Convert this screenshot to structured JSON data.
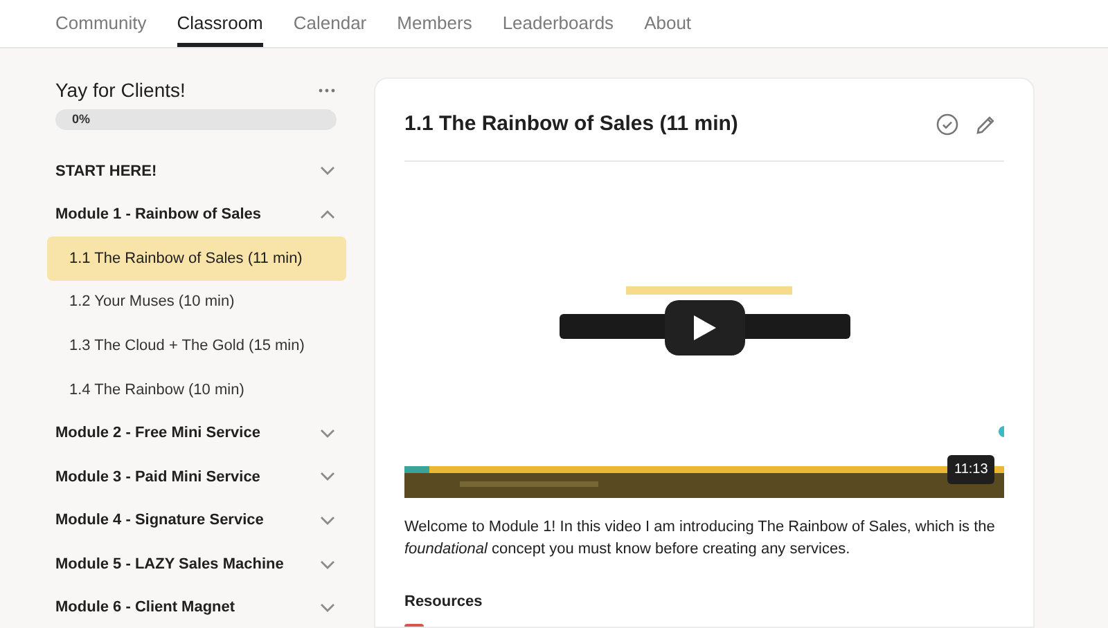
{
  "nav": [
    {
      "label": "Community",
      "selected": false
    },
    {
      "label": "Classroom",
      "selected": true
    },
    {
      "label": "Calendar",
      "selected": false
    },
    {
      "label": "Members",
      "selected": false
    },
    {
      "label": "Leaderboards",
      "selected": false
    },
    {
      "label": "About",
      "selected": false
    }
  ],
  "course": {
    "title": "Yay for Clients!",
    "progress": {
      "level": 0,
      "reading": "0%"
    }
  },
  "outline": [
    {
      "kind": "module",
      "label": "START HERE!",
      "expanded": false
    },
    {
      "kind": "module",
      "label": "Module 1 - Rainbow of Sales",
      "expanded": true,
      "children": [
        {
          "label": "1.1 The Rainbow of Sales (11 min)",
          "selected": true
        },
        {
          "label": "1.2 Your Muses (10 min)",
          "selected": false
        },
        {
          "label": "1.3 The Cloud + The Gold (15 min)",
          "selected": false
        },
        {
          "label": "1.4 The Rainbow (10 min)",
          "selected": false
        }
      ]
    },
    {
      "kind": "module",
      "label": "Module 2 - Free Mini Service",
      "expanded": false
    },
    {
      "kind": "module",
      "label": "Module 3 - Paid Mini Service",
      "expanded": false
    },
    {
      "kind": "module",
      "label": "Module 4 - Signature Service",
      "expanded": false
    },
    {
      "kind": "module",
      "label": "Module 5 - LAZY Sales Machine",
      "expanded": false
    },
    {
      "kind": "module",
      "label": "Module 6 - Client Magnet",
      "expanded": false
    }
  ],
  "lesson": {
    "title": "1.1 The Rainbow of Sales (11 min)",
    "completed": false,
    "video": {
      "duration": "11:13"
    },
    "description": "Welcome to Module 1! In this video I am introducing The Rainbow of Sales, which is the *foundational* concept you must know before creating any services.",
    "resources_heading": "Resources"
  }
}
